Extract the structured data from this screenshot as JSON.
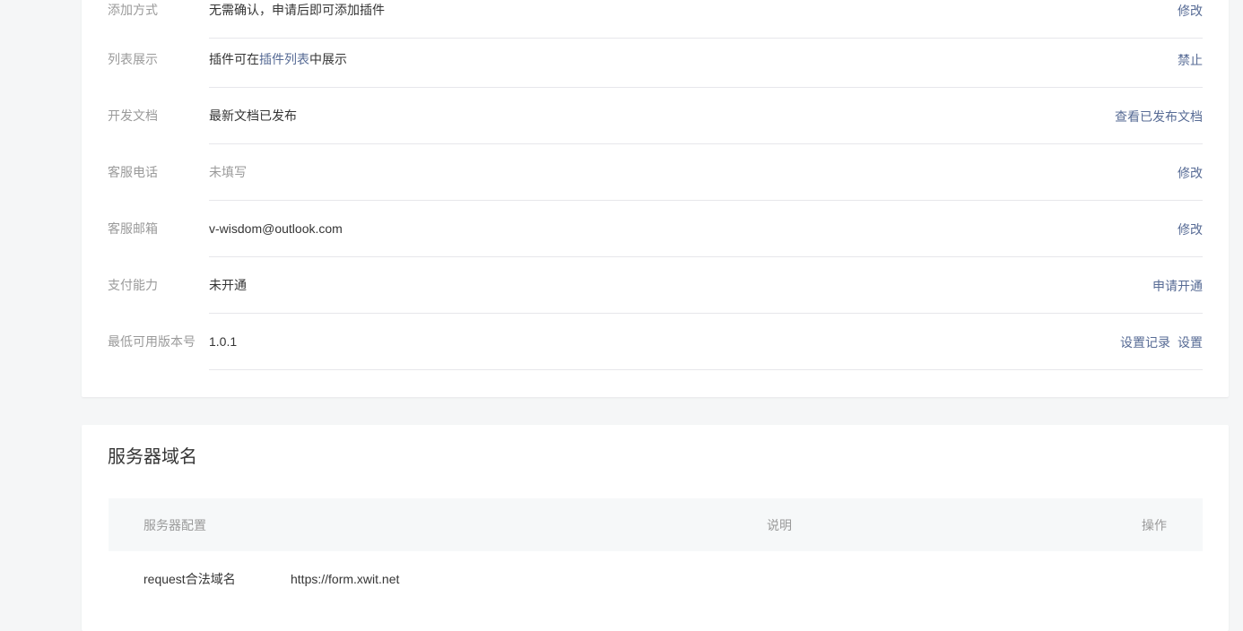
{
  "settings": {
    "rows": [
      {
        "label": "添加方式",
        "value": "无需确认，申请后即可添加插件",
        "actions": [
          "修改"
        ]
      },
      {
        "label": "列表展示",
        "value_prefix": "插件可在",
        "value_link": "插件列表",
        "value_suffix": "中展示",
        "actions": [
          "禁止"
        ]
      },
      {
        "label": "开发文档",
        "value": "最新文档已发布",
        "actions": [
          "查看已发布文档"
        ]
      },
      {
        "label": "客服电话",
        "value": "未填写",
        "actions": [
          "修改"
        ]
      },
      {
        "label": "客服邮箱",
        "value": "v-wisdom@outlook.com",
        "actions": [
          "修改"
        ]
      },
      {
        "label": "支付能力",
        "value": "未开通",
        "actions": [
          "申请开通"
        ]
      },
      {
        "label": "最低可用版本号",
        "value": "1.0.1",
        "actions": [
          "设置记录",
          "设置"
        ]
      }
    ]
  },
  "domain": {
    "title": "服务器域名",
    "columns": [
      "服务器配置",
      "说明",
      "操作"
    ],
    "rows": [
      {
        "config": "request合法域名",
        "value": "https://form.xwit.net"
      }
    ]
  },
  "colors": {
    "link": "#576b95",
    "label": "#9a9a9a",
    "text": "#353535",
    "background": "#f5f6f7"
  }
}
